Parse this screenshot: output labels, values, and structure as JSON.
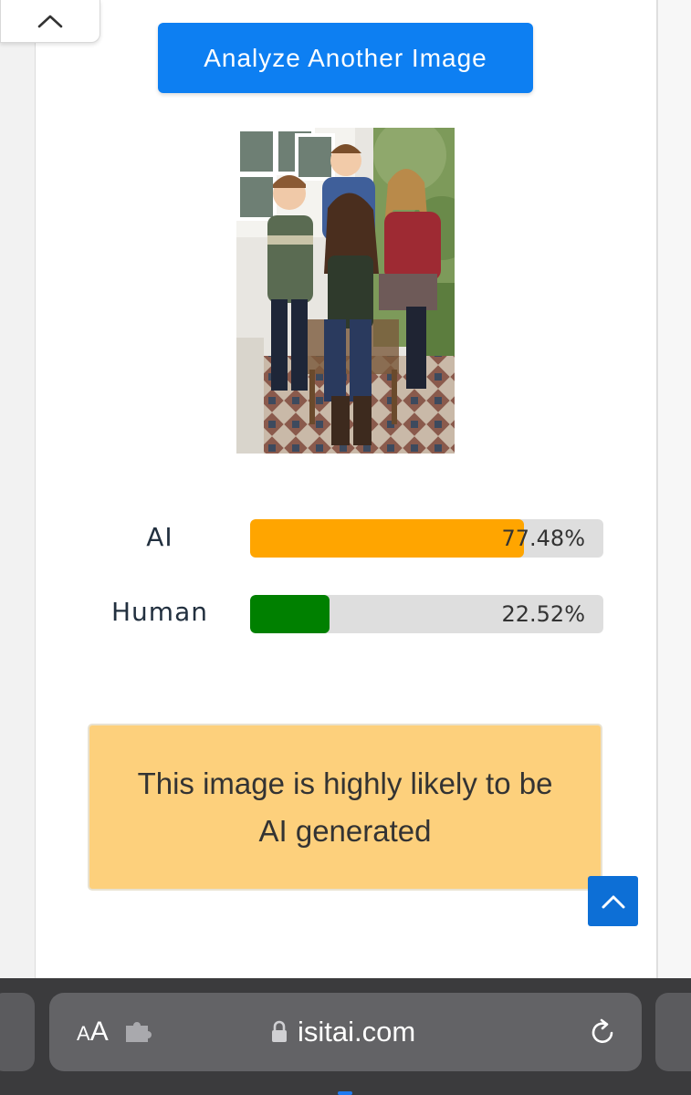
{
  "page": {
    "collapse_icon": "chevron-up-icon",
    "analyze_button_label": "Analyze Another Image",
    "photo_subject": "family-portrait"
  },
  "results": [
    {
      "label": "AI",
      "value_text": "77.48%",
      "fraction": 0.7748,
      "color": "#ffa500"
    },
    {
      "label": "Human",
      "value_text": "22.52%",
      "fraction": 0.2252,
      "color": "#008000"
    }
  ],
  "verdict": {
    "text": "This image is highly likely to be AI generated",
    "background": "#fdd07c"
  },
  "scroll_top_icon": "chevron-up-icon",
  "browser": {
    "aa_small": "A",
    "aa_big": "A",
    "extension_icon": "puzzle-icon",
    "lock_icon": "lock-icon",
    "url": "isitai.com",
    "reload_icon": "reload-icon"
  },
  "colors": {
    "accent": "#0d7ff2",
    "ai_bar": "#ffa500",
    "human_bar": "#008000",
    "track": "#dedede"
  }
}
